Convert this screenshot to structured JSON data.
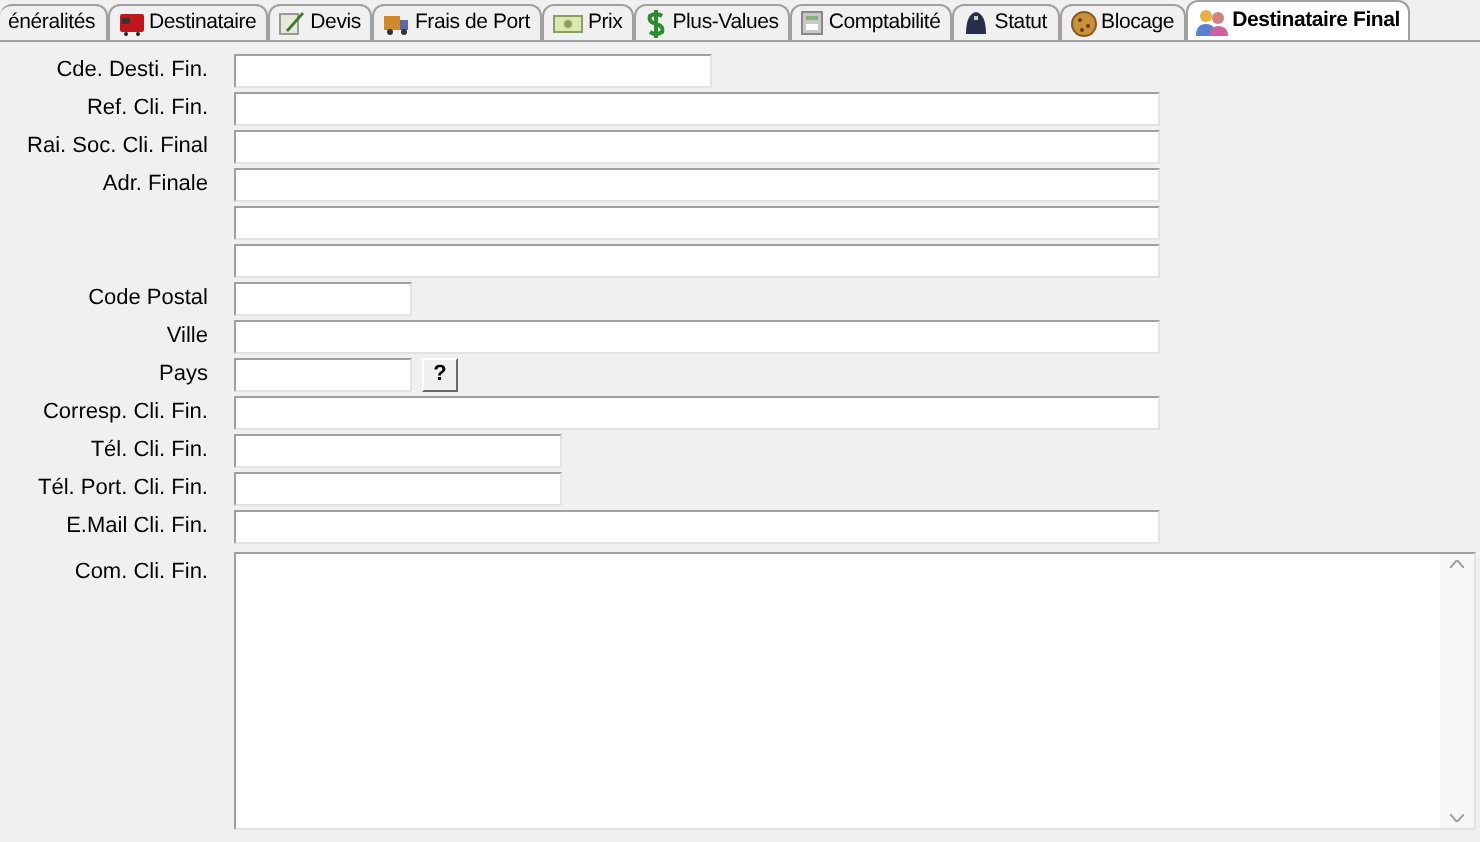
{
  "tabs": [
    {
      "label": "énéralités",
      "selected": false
    },
    {
      "label": "Destinataire",
      "selected": false
    },
    {
      "label": "Devis",
      "selected": false
    },
    {
      "label": "Frais de Port",
      "selected": false
    },
    {
      "label": "Prix",
      "selected": false
    },
    {
      "label": "Plus-Values",
      "selected": false
    },
    {
      "label": "Comptabilité",
      "selected": false
    },
    {
      "label": "Statut",
      "selected": false
    },
    {
      "label": "Blocage",
      "selected": false
    },
    {
      "label": "Destinataire Final",
      "selected": true
    }
  ],
  "form": {
    "fields": [
      {
        "kind": "text",
        "label": "Cde. Desti. Fin."
      },
      {
        "kind": "text",
        "label": "Ref. Cli. Fin."
      },
      {
        "kind": "text",
        "label": "Rai. Soc. Cli. Final"
      },
      {
        "kind": "text",
        "label": "Adr. Finale"
      },
      {
        "kind": "text"
      },
      {
        "kind": "text"
      },
      {
        "kind": "text",
        "label": "Code Postal"
      },
      {
        "kind": "text",
        "label": "Ville"
      },
      {
        "kind": "lookup",
        "label": "Pays",
        "button": "?"
      },
      {
        "kind": "text",
        "label": "Corresp. Cli. Fin."
      },
      {
        "kind": "text",
        "label": "Tél. Cli. Fin."
      },
      {
        "kind": "text",
        "label": "Tél. Port. Cli. Fin."
      },
      {
        "kind": "text",
        "label": "E.Mail Cli. Fin."
      }
    ],
    "comment": {
      "label": "Com. Cli. Fin."
    }
  }
}
